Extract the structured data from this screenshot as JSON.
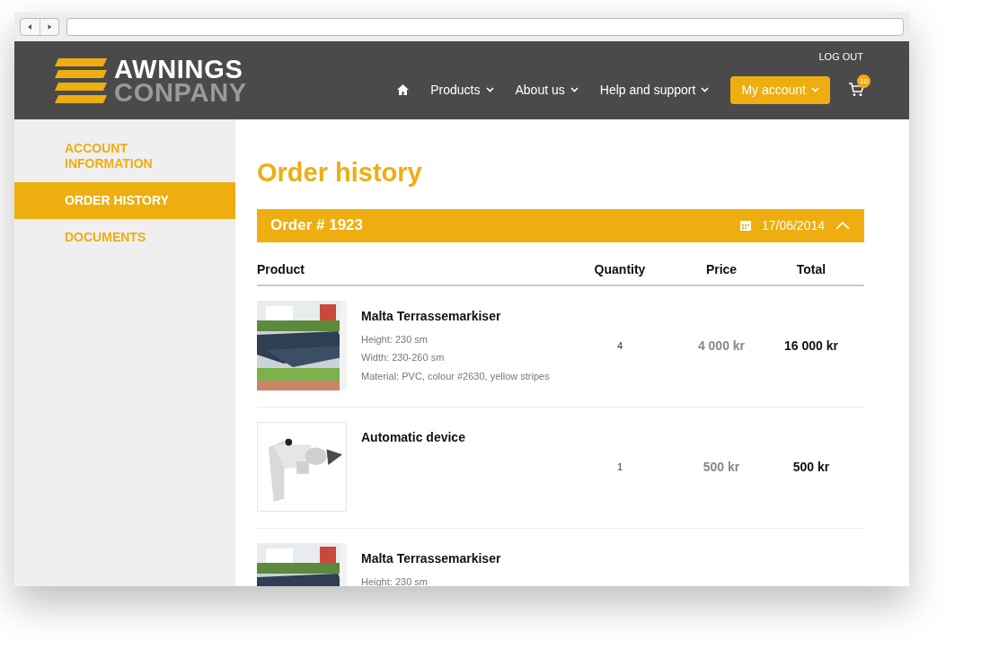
{
  "header": {
    "logo_top": "AWNINGS",
    "logo_bottom": "CONPANY",
    "logout": "LOG OUT",
    "nav": [
      {
        "kind": "home"
      },
      {
        "kind": "menu",
        "label": "Products"
      },
      {
        "kind": "menu",
        "label": "About us"
      },
      {
        "kind": "menu",
        "label": "Help and support"
      },
      {
        "kind": "account",
        "label": "My account"
      }
    ],
    "cart_count": "10"
  },
  "sidebar": {
    "items": [
      {
        "label": "ACCOUNT INFORMATION",
        "selected": false
      },
      {
        "label": "ORDER HISTORY",
        "selected": true
      },
      {
        "label": "DOCUMENTS",
        "selected": false
      }
    ]
  },
  "page_title": "Order history",
  "order": {
    "title": "Order # 1923",
    "date": "17/06/2014",
    "expanded": true,
    "columns": [
      "Product",
      "Quantity",
      "Price",
      "Total"
    ],
    "rows": [
      {
        "kind": "awning",
        "name": "Malta Terrassemarkiser",
        "details": [
          "Height: 230 sm",
          "Width: 230-260 sm",
          "Material: PVC, colour #2630, yellow stripes"
        ],
        "quantity": "4",
        "price": "4 000 kr",
        "total": "16 000 kr"
      },
      {
        "kind": "device",
        "name": "Automatic device",
        "details": [],
        "quantity": "1",
        "price": "500 kr",
        "total": "500 kr"
      },
      {
        "kind": "awning",
        "name": "Malta Terrassemarkiser",
        "details": [
          "Height: 230 sm"
        ]
      }
    ]
  }
}
